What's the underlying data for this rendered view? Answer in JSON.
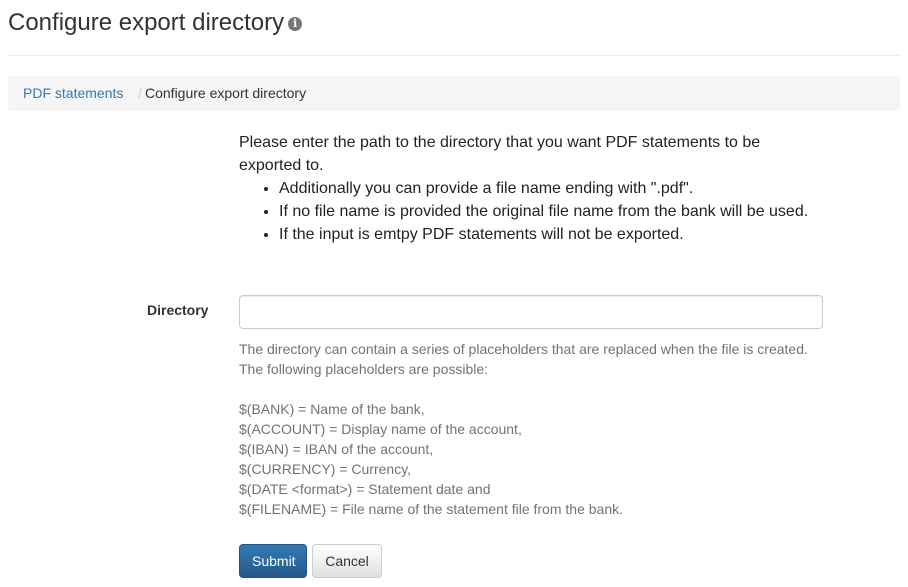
{
  "header": {
    "title": "Configure export directory",
    "info_icon": "info-circle-icon",
    "info_glyph": "i"
  },
  "breadcrumb": {
    "link_label": "PDF statements",
    "separator": "/",
    "active_label": "Configure export directory"
  },
  "intro": {
    "paragraph": "Please enter the path to the directory that you want PDF statements to be exported to.",
    "bullets": [
      "Additionally you can provide a file name ending with \".pdf\".",
      "If no file name is provided the original file name from the bank will be used.",
      "If the input is emtpy PDF statements will not be exported."
    ]
  },
  "form": {
    "directory_label": "Directory",
    "directory_value": "",
    "help_lines": [
      "The directory can contain a series of placeholders that are replaced when the file is created.",
      "The following placeholders are possible:",
      "$(BANK) = Name of the bank,",
      "$(ACCOUNT) = Display name of the account,",
      "$(IBAN) = IBAN of the account,",
      "$(CURRENCY) = Currency,",
      "$(DATE <format>) = Statement date and",
      "$(FILENAME) = File name of the statement file from the bank."
    ]
  },
  "actions": {
    "submit_label": "Submit",
    "cancel_label": "Cancel"
  },
  "colors": {
    "link": "#337ab7",
    "primary_button": "#265a88",
    "help_text": "#737373",
    "breadcrumb_bg": "#f5f5f5"
  }
}
